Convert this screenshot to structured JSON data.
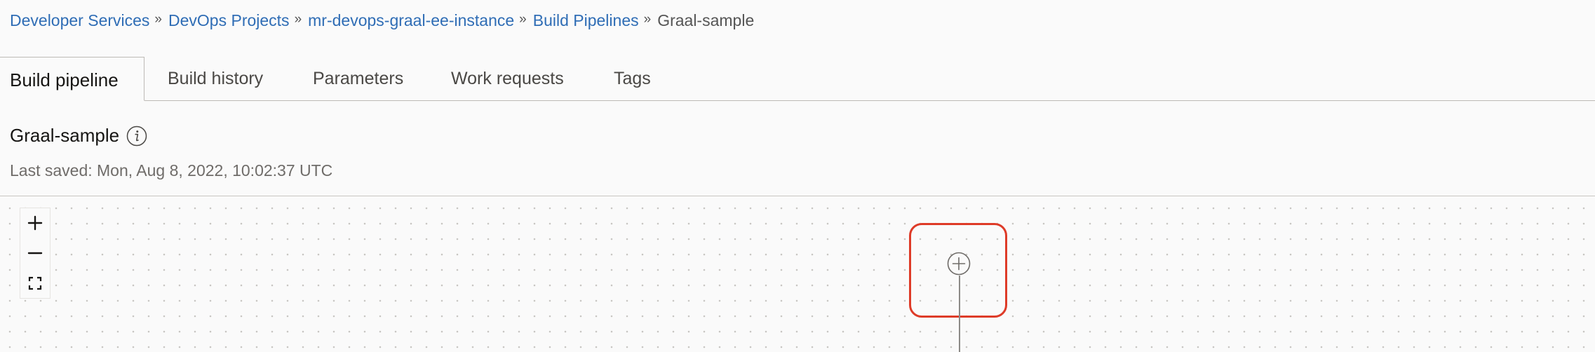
{
  "breadcrumb": {
    "items": [
      {
        "label": "Developer Services"
      },
      {
        "label": "DevOps Projects"
      },
      {
        "label": "mr-devops-graal-ee-instance"
      },
      {
        "label": "Build Pipelines"
      }
    ],
    "separator": "»",
    "current": "Graal-sample"
  },
  "tabs": [
    {
      "label": "Build pipeline",
      "active": true
    },
    {
      "label": "Build history"
    },
    {
      "label": "Parameters"
    },
    {
      "label": "Work requests"
    },
    {
      "label": "Tags"
    }
  ],
  "pipeline": {
    "title": "Graal-sample",
    "last_saved": "Last saved: Mon, Aug 8, 2022, 10:02:37 UTC"
  },
  "canvas": {
    "zoom_controls": [
      "zoom-in-icon",
      "zoom-out-icon",
      "fit-to-screen-icon"
    ],
    "add_stage_icon": "plus-circle-icon"
  },
  "colors": {
    "link": "#2f6db5",
    "highlight": "#de3b28",
    "text": "#161513",
    "muted": "#6f6c69"
  }
}
